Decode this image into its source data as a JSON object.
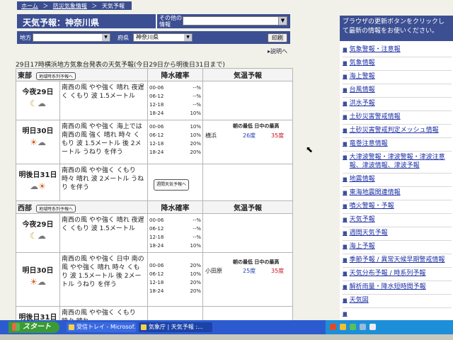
{
  "breadcrumb": [
    "ホーム",
    "防災気象情報",
    "天気予報"
  ],
  "breadcrumb_sep": "＞",
  "page": {
    "title": "天気予報：神奈川県",
    "other_info_label": "その他の情報",
    "help_label": "説明へ",
    "issued": "29日17時横浜地方気象台発表の天気予報(今日29日から明後日31日まで)"
  },
  "filter": {
    "region_label": "地方",
    "prefecture_label": "府県",
    "prefecture_value": "神奈川県",
    "print_label": "印刷"
  },
  "labels": {
    "weekly_btn": "地域時系列予報へ",
    "weekly_small": "週間天気予報へ",
    "pop_header": "降水確率",
    "temp_header": "気温予報",
    "pop_slots": [
      "00-06",
      "06-12",
      "12-18",
      "18-24"
    ],
    "temp_cols": "朝の最低 日中の最高"
  },
  "regions": [
    {
      "name": "東部",
      "days": [
        {
          "day": "今夜29日",
          "desc": "南西の風 やや強く 晴れ 夜遅く くもり 波 1.5メートル",
          "pop": [
            "--%",
            "--%",
            "--%",
            "10%"
          ]
        },
        {
          "day": "明日30日",
          "desc": "南西の風 やや強く 海上では 南西の風 強く 晴れ 時々 くもり 波 1.5メートル 後 2メートル うねり を伴う",
          "pop": [
            "10%",
            "10%",
            "20%",
            "20%"
          ],
          "city": "横浜",
          "min": "26度",
          "max": "35度"
        },
        {
          "day": "明後日31日",
          "desc": "南西の風 やや強く くもり 時々 晴れ 波 2メートル うねり を伴う"
        }
      ]
    },
    {
      "name": "西部",
      "days": [
        {
          "day": "今夜29日",
          "desc": "南西の風 やや強く 晴れ 夜遅く くもり 波 1.5メートル",
          "pop": [
            "--%",
            "--%",
            "--%",
            "10%"
          ]
        },
        {
          "day": "明日30日",
          "desc": "南西の風 やや強く 日中 南の風 やや強く 晴れ 時々 くもり 波 1.5メートル 後 2メートル うねり を伴う",
          "pop": [
            "20%",
            "10%",
            "20%",
            "20%"
          ],
          "city": "小田原",
          "min": "25度",
          "max": "35度"
        },
        {
          "day": "明後日31日",
          "desc": "南西の風 やや強く くもり 時々 晴れ"
        }
      ]
    }
  ],
  "sidebar": {
    "notice": "ブラウザの更新ボタンをクリックして最新の情報をお使いください。",
    "links": [
      "気象警報・注意報",
      "気象情報",
      "海上警報",
      "台風情報",
      "洪水予報",
      "土砂災害警戒情報",
      "土砂災害警戒判定メッシュ情報",
      "竜巻注意情報",
      "大津波警報・津波警報・津波注意報、津波情報、津波予報",
      "地震情報",
      "東海地震関連情報",
      "噴火警報・予報",
      "天気予報",
      "週間天気予報",
      "海上予報",
      "季節予報 / 異常天候早期警戒情報",
      "天気分布予報 / 時系列予報",
      "解析雨量・降水短時間予報",
      "天気図",
      ""
    ]
  },
  "taskbar": {
    "start": "スタート",
    "tasks": [
      "受信トレイ - Microsof...",
      "気象庁 | 天気予報 :..."
    ]
  },
  "colors": {
    "accent": "#3c4f93",
    "link": "#1c2fa5",
    "min_temp": "#1e3fb5",
    "max_temp": "#c8121e"
  }
}
